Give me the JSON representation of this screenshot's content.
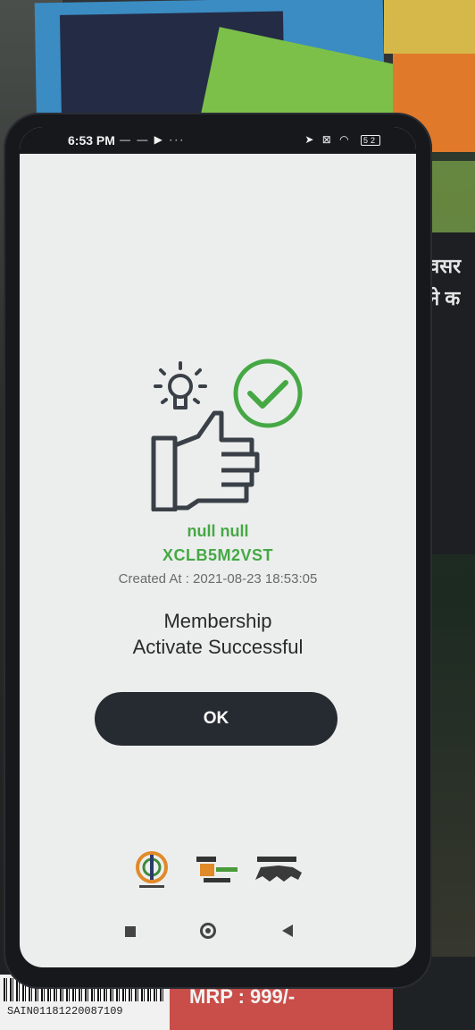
{
  "status_bar": {
    "time": "6:53 PM",
    "left_icons": "— — ▶ ···",
    "right_icons": "➤ ⊠ ◠",
    "battery": "52"
  },
  "illustration": {
    "icons": [
      "lightbulb-icon",
      "thumbs-up-icon",
      "check-circle-icon"
    ],
    "accent_color": "#46a845",
    "line_color": "#3a4047"
  },
  "result": {
    "name": "null null",
    "code": "XCLB5M2VST",
    "created_at": "Created At : 2021-08-23 18:53:05",
    "message_line1": "Membership",
    "message_line2": "Activate Successful"
  },
  "ok_button": {
    "label": "OK"
  },
  "footer_logos": [
    "azadi-ka-amrit-mahotsav-logo",
    "vocal-for-local-logo",
    "make-in-india-logo"
  ],
  "nav_bar": [
    "recents-button",
    "home-button",
    "back-button"
  ],
  "environment": {
    "barcode_text": "SAIN01181220087109",
    "mrp": "MRP : 999/-",
    "book_text": "वसर\nने क"
  }
}
